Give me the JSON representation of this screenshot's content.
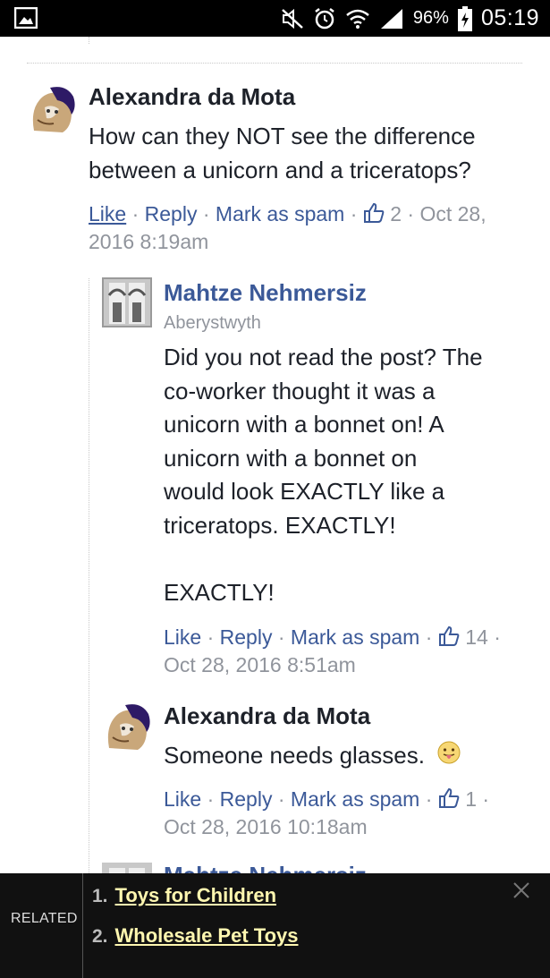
{
  "status_bar": {
    "battery_percent": "96%",
    "time": "05:19",
    "icons": [
      "gallery-icon",
      "mute-icon",
      "alarm-icon",
      "wifi-icon",
      "signal-icon",
      "battery-icon"
    ]
  },
  "comments": [
    {
      "author": "Alexandra da Mota",
      "text": "How can they NOT see the difference between a unicorn and a triceratops?",
      "actions": {
        "like": "Like",
        "reply": "Reply",
        "spam": "Mark as spam"
      },
      "likes": "2",
      "timestamp": "Oct 28, 2016 8:19am"
    },
    {
      "author": "Mahtze Nehmersiz",
      "location": "Aberystwyth",
      "text_lines": [
        "Did you not read the post? The",
        "co-worker thought it was a",
        "unicorn with a bonnet on! A",
        "unicorn with a bonnet on",
        "would look EXACTLY like a",
        "triceratops. EXACTLY!",
        "",
        "EXACTLY!"
      ],
      "actions": {
        "like": "Like",
        "reply": "Reply",
        "spam": "Mark as spam"
      },
      "likes": "14",
      "timestamp": "Oct 28, 2016 8:51am"
    },
    {
      "author": "Alexandra da Mota",
      "text": "Someone needs glasses.",
      "actions": {
        "like": "Like",
        "reply": "Reply",
        "spam": "Mark as spam"
      },
      "likes": "1",
      "timestamp": "Oct 28, 2016 10:18am"
    },
    {
      "author": "Mahtze Nehmersiz"
    }
  ],
  "related": {
    "label": "RELATED",
    "items": [
      {
        "num": "1.",
        "text": "Toys for Children"
      },
      {
        "num": "2.",
        "text": "Wholesale Pet Toys"
      }
    ]
  },
  "colors": {
    "link": "#3b5998",
    "meta": "#90949c",
    "text": "#1d2129",
    "related_bg": "#111111",
    "related_link": "#fff7b0"
  }
}
